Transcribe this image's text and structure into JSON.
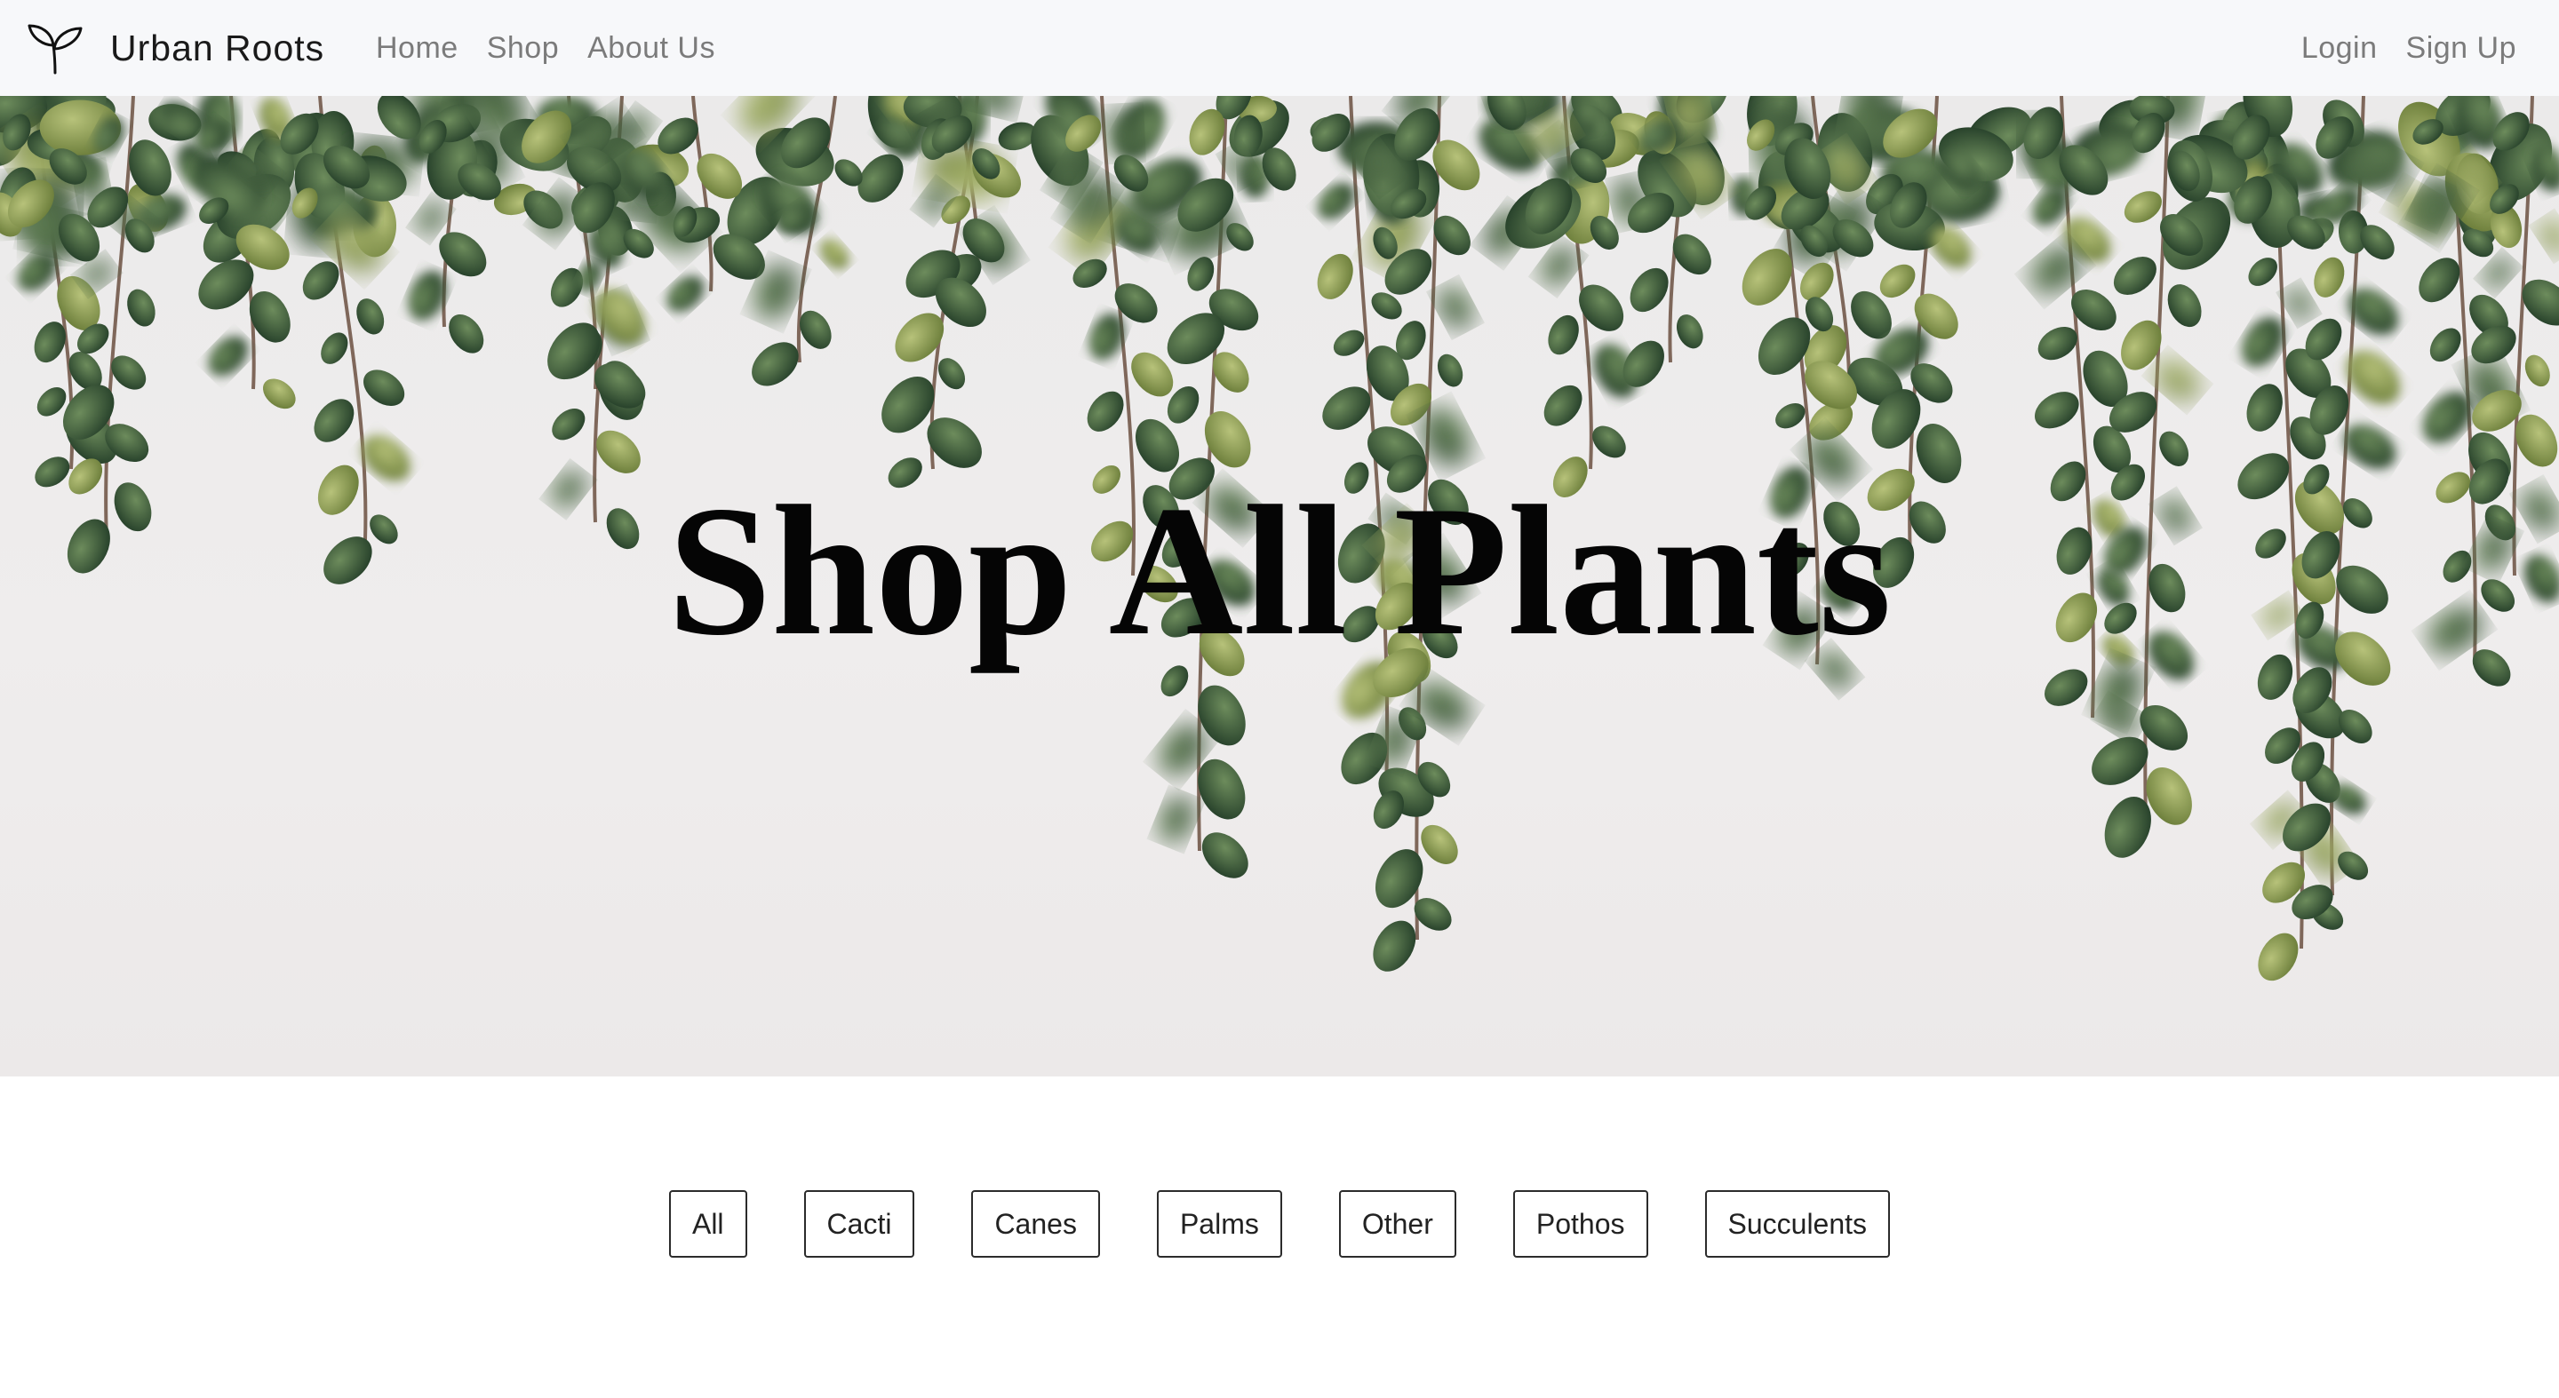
{
  "nav": {
    "brand": "Urban Roots",
    "brand_icon": "sprout-icon",
    "links": [
      "Home",
      "Shop",
      "About Us"
    ],
    "right_links": [
      "Login",
      "Sign Up"
    ]
  },
  "hero": {
    "title": "Shop All Plants",
    "background": "hanging-plant-photo"
  },
  "filters": {
    "options": [
      "All",
      "Cacti",
      "Canes",
      "Palms",
      "Other",
      "Pothos",
      "Succulents"
    ]
  },
  "colors": {
    "navbar_bg": "#f7f8fa",
    "nav_link": "#7b7b7b",
    "leaf_dark": "#2f4a32",
    "leaf_mid": "#4f6e43"
  }
}
